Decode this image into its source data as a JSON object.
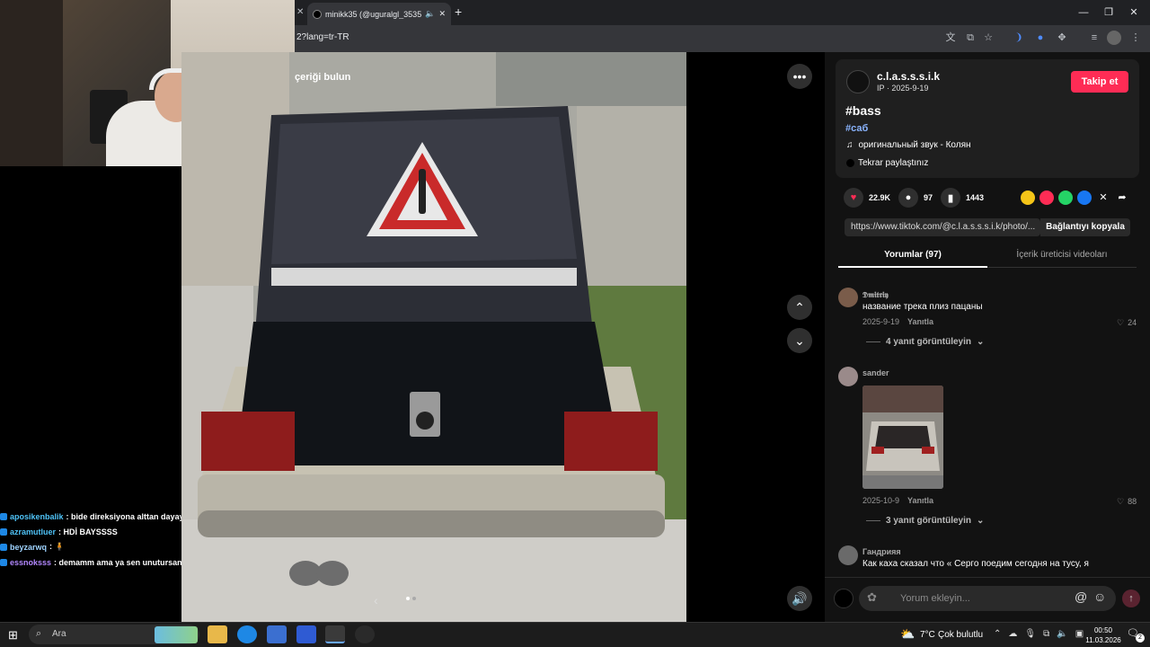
{
  "browser": {
    "tab_title": "minikk35 (@uguralgl_3535)",
    "url": "2?lang=tr-TR",
    "new_tab": "+"
  },
  "overlay": {
    "partial_text": "çeriği bulun"
  },
  "chat": [
    {
      "user": "aposikenbalik",
      "text": ": bide direksiyona alttan dayayıp",
      "color": "#4fc3f7"
    },
    {
      "user": "azramutluer",
      "text": ": HDİ BAYSSSS",
      "color": "#4fc3f7"
    },
    {
      "user": "beyzarwq",
      "text": ": 🧍",
      "color": "#9fd3ff"
    },
    {
      "user": "essnoksss",
      "text": ": demamm ama ya sen unutursan",
      "color": "#b388ff"
    }
  ],
  "post": {
    "author_name": "c.l.a.s.s.s.i.k",
    "author_meta": "IP · 2025-9-19",
    "follow_label": "Takip et",
    "title": "#bass",
    "hashtag": "#саб",
    "sound": "оригинальный звук - Колян",
    "repost": "Tekrar paylaştınız",
    "likes": "22.9K",
    "comments": "97",
    "saves": "1443",
    "link": "https://www.tiktok.com/@c.l.a.s.s.s.i.k/photo/...",
    "copy_label": "Bağlantıyı kopyala"
  },
  "tabs": {
    "comments_tab": "Yorumlar (97)",
    "creator_tab": "İçerik üreticisi videoları"
  },
  "comments": [
    {
      "name": "𝕯𝖒𝖎𝖙𝖗𝖎𝖞",
      "text": "название трека плиз пацаны",
      "date": "2025-9-19",
      "reply": "Yanıtla",
      "likes": "24",
      "view_replies": "4 yanıt görüntüleyin"
    },
    {
      "name": "sander",
      "text": "",
      "date": "2025-10-9",
      "reply": "Yanıtla",
      "likes": "88",
      "view_replies": "3 yanıt görüntüleyin"
    },
    {
      "name": "Гандрияя",
      "text": "Как каха сказал что « Серго поедим сегодня на тусу, я",
      "date": "",
      "reply": "",
      "likes": "",
      "view_replies": ""
    }
  ],
  "comment_input": {
    "placeholder": "Yorum ekleyin..."
  },
  "taskbar": {
    "search": "Ara",
    "weather_temp": "7°C",
    "weather_text": "Çok bulutlu",
    "time": "00:50",
    "date": "11.03.2026",
    "notifications": "2"
  },
  "colors": {
    "accent": "#fe2c55",
    "hashtag_blue": "#8ab4ff",
    "panel_bg": "#121212"
  },
  "icons": {
    "more": "more-icon",
    "up": "chevron-up-icon",
    "down": "chevron-down-icon",
    "mute": "volume-icon"
  }
}
